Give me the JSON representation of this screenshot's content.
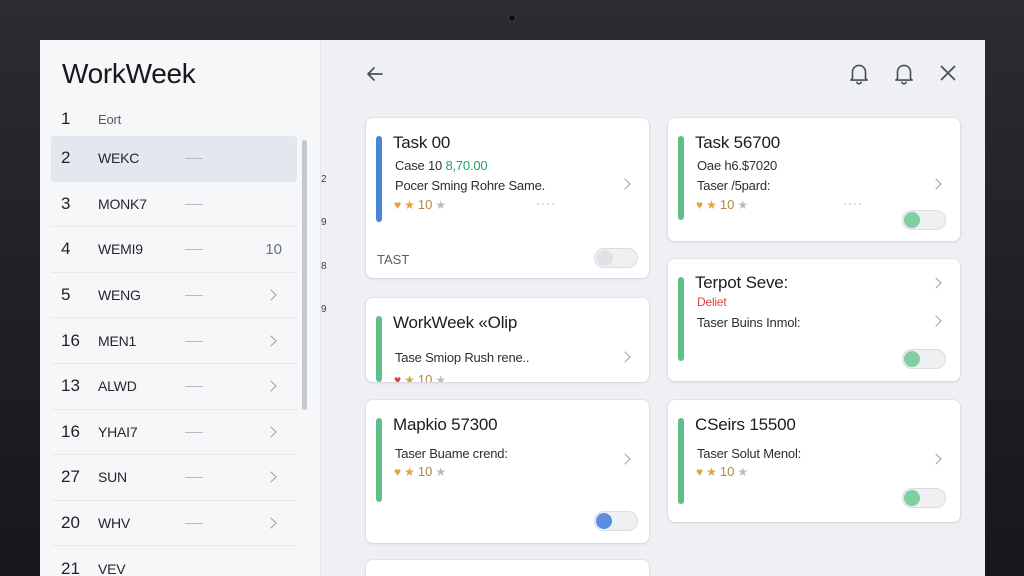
{
  "app": {
    "title": "WorkWeek"
  },
  "sidebar": {
    "items": [
      {
        "num": "1",
        "label": "Eort",
        "count": "",
        "chevron": false,
        "dash": false
      },
      {
        "num": "2",
        "label": "WEKC",
        "count": "",
        "chevron": false,
        "dash": true,
        "active": true
      },
      {
        "num": "3",
        "label": "MONK7",
        "count": "",
        "chevron": false,
        "dash": true
      },
      {
        "num": "4",
        "label": "WEMI9",
        "count": "10",
        "chevron": false,
        "dash": true
      },
      {
        "num": "5",
        "label": "WENG",
        "count": "",
        "chevron": true,
        "dash": true
      },
      {
        "num": "16",
        "label": "MEN1",
        "count": "",
        "chevron": true,
        "dash": true
      },
      {
        "num": "13",
        "label": "ALWD",
        "count": "",
        "chevron": true,
        "dash": true
      },
      {
        "num": "16",
        "label": "YHAI7",
        "count": "",
        "chevron": true,
        "dash": true
      },
      {
        "num": "27",
        "label": "SUN",
        "count": "",
        "chevron": true,
        "dash": true
      },
      {
        "num": "20",
        "label": "WHV",
        "count": "",
        "chevron": true,
        "dash": true
      },
      {
        "num": "21",
        "label": "VEV",
        "count": "",
        "chevron": false,
        "dash": false
      }
    ]
  },
  "strip": [
    "2",
    "9",
    "8",
    "9"
  ],
  "header": {
    "back_icon": "arrow-left-icon",
    "bell_icon": "bell-icon",
    "close_icon": "close-icon"
  },
  "cards": [
    {
      "title": "Task 00",
      "line1_prefix": "Case 10 ",
      "line1_highlight": "8,70.00",
      "line2": "Pocer Sming Rohre Same.",
      "rating": "10",
      "footer": "TAST",
      "accent": "#4a86d8",
      "toggle_on": false
    },
    {
      "title": "Task 56700",
      "line1_prefix": "Oae h6.$7020",
      "line1_highlight": "",
      "line2": "Taser /5pard:",
      "rating": "10",
      "accent": "#5fbf86",
      "toggle_on": true
    },
    {
      "title": "WorkWeek «Olip",
      "line2": "Tase  Smiop Rush rene..",
      "rating": "10",
      "accent": "#5fbf86"
    },
    {
      "title": "Terpot  Seve:",
      "red": "Deliet",
      "line2": "Taser Buins Inmol:",
      "accent": "#5fbf86",
      "toggle_on": true
    },
    {
      "title": "Mapkio 57300",
      "line2": "Taser Buame crend:",
      "rating": "10",
      "accent": "#5fbf86",
      "toggle_on": true
    },
    {
      "title": "CSeirs 15500",
      "line2": "Taser Solut  Menol:",
      "rating": "10",
      "accent": "#5fbf86",
      "toggle_on": true
    }
  ],
  "colors": {
    "green": "#5fbf86",
    "blue": "#4a86d8",
    "red": "#d64545",
    "star": "#e3a23b"
  }
}
